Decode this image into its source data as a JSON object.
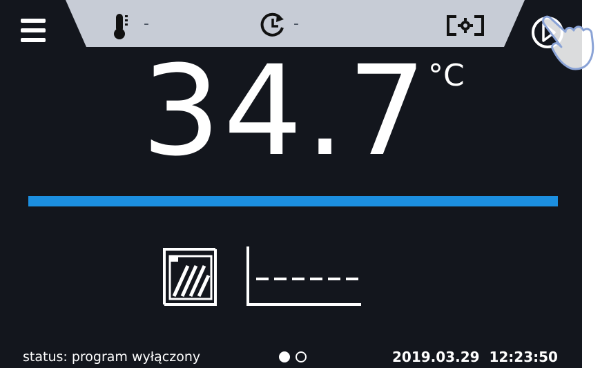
{
  "topbar": {
    "temperature_setpoint": "-",
    "timer_value": "-",
    "icons": [
      "thermometer-icon",
      "timer-icon",
      "camera-icon",
      "power-icon"
    ]
  },
  "display": {
    "temperature": "34.7",
    "unit": "°C"
  },
  "main": {
    "icons": [
      "door-icon",
      "graph-icon"
    ]
  },
  "status": {
    "text": "status: program wyłączony",
    "datetime": "2019.03.29  12:23:50",
    "page_count": 2,
    "active_page": 1
  },
  "colors": {
    "background": "#13161d",
    "topbar": "#c7ccd6",
    "accent_bar": "#1c8fe0",
    "text": "#ffffff"
  }
}
